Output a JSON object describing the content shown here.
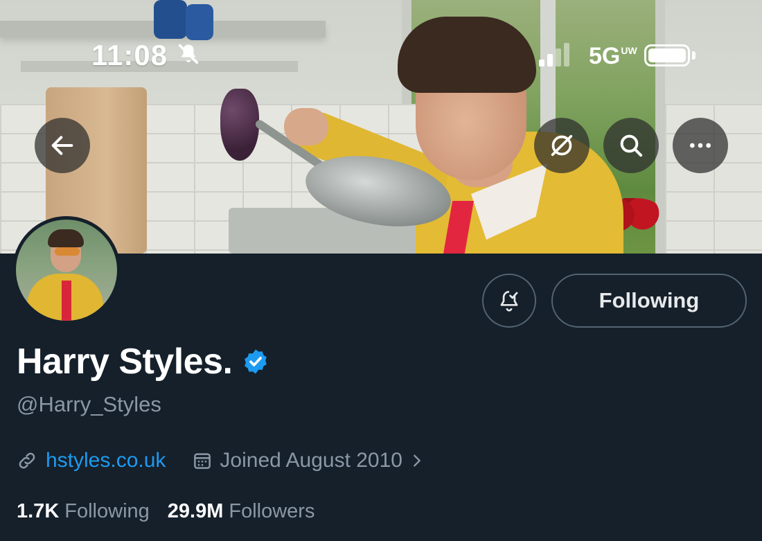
{
  "status_bar": {
    "time": "11:08",
    "network": "5G",
    "network_badge": "UW"
  },
  "header_buttons": {
    "back_icon": "arrow-left-icon",
    "grok_icon": "slash-circle-icon",
    "search_icon": "search-icon",
    "more_icon": "more-horizontal-icon"
  },
  "profile": {
    "display_name": "Harry Styles.",
    "verified": true,
    "handle": "@Harry_Styles",
    "website": "hstyles.co.uk",
    "joined": "Joined August 2010",
    "following_count": "1.7K",
    "following_label": "Following",
    "followers_count": "29.9M",
    "followers_label": "Followers"
  },
  "actions": {
    "following_button": "Following",
    "notify_icon": "bell-check-icon"
  },
  "colors": {
    "background": "#15202b",
    "accent": "#1d9bf0",
    "secondary_text": "#8b98a5",
    "border": "#536471"
  }
}
